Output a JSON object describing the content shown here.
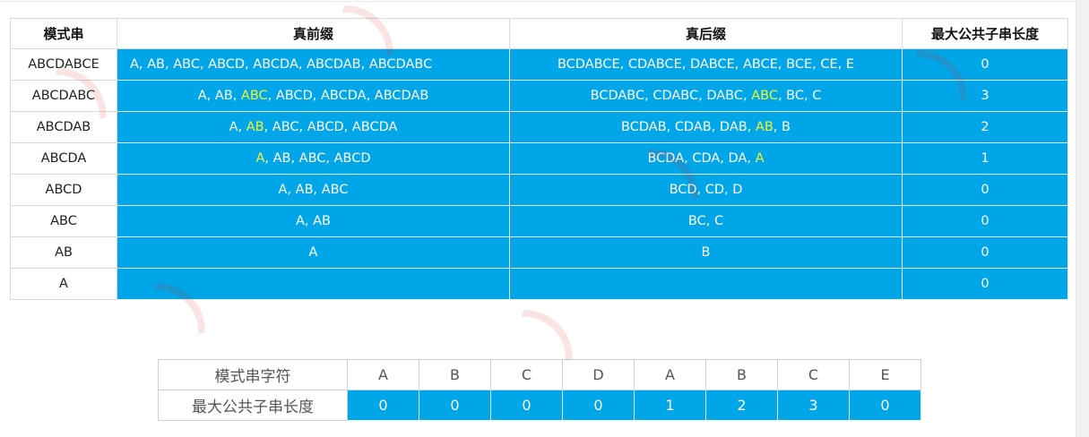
{
  "main_table": {
    "headers": [
      "模式串",
      "真前缀",
      "真后缀",
      "最大公共子串长度"
    ],
    "rows": [
      {
        "pattern": "ABCDABCE",
        "prefix": [
          {
            "t": "A, AB, ABC, ABCD, ABCDA, ABCDAB, ABCDABC"
          }
        ],
        "suffix": [
          {
            "t": "BCDABCE, CDABCE, DABCE, ABCE, BCE, CE, E"
          }
        ],
        "length": "0"
      },
      {
        "pattern": "ABCDABC",
        "prefix": [
          {
            "t": "A, AB, "
          },
          {
            "t": "ABC",
            "hl": true
          },
          {
            "t": ", ABCD, ABCDA, ABCDAB"
          }
        ],
        "suffix": [
          {
            "t": "BCDABC, CDABC, DABC, "
          },
          {
            "t": "ABC",
            "hl": true
          },
          {
            "t": ", BC, C"
          }
        ],
        "length": "3"
      },
      {
        "pattern": "ABCDAB",
        "prefix": [
          {
            "t": "A, "
          },
          {
            "t": "AB",
            "hl": true
          },
          {
            "t": ", ABC, ABCD, ABCDA"
          }
        ],
        "suffix": [
          {
            "t": "BCDAB, CDAB, DAB, "
          },
          {
            "t": "AB",
            "hl": true
          },
          {
            "t": ", B"
          }
        ],
        "length": "2"
      },
      {
        "pattern": "ABCDA",
        "prefix": [
          {
            "t": "A",
            "hl": true
          },
          {
            "t": ", AB, ABC, ABCD"
          }
        ],
        "suffix": [
          {
            "t": "BCDA, CDA, DA, "
          },
          {
            "t": "A",
            "hl": true
          }
        ],
        "length": "1"
      },
      {
        "pattern": "ABCD",
        "prefix": [
          {
            "t": "A, AB, ABC"
          }
        ],
        "suffix": [
          {
            "t": "BCD, CD, D"
          }
        ],
        "length": "0"
      },
      {
        "pattern": "ABC",
        "prefix": [
          {
            "t": "A, AB"
          }
        ],
        "suffix": [
          {
            "t": "BC, C"
          }
        ],
        "length": "0"
      },
      {
        "pattern": "AB",
        "prefix": [
          {
            "t": "A"
          }
        ],
        "suffix": [
          {
            "t": "B"
          }
        ],
        "length": "0"
      },
      {
        "pattern": "A",
        "prefix": [],
        "suffix": [],
        "length": "0"
      }
    ]
  },
  "char_table": {
    "row1_label": "模式串字符",
    "chars": [
      "A",
      "B",
      "C",
      "D",
      "A",
      "B",
      "C",
      "E"
    ],
    "row2_label": "最大公共子串长度",
    "values": [
      "0",
      "0",
      "0",
      "0",
      "1",
      "2",
      "3",
      "0"
    ]
  },
  "colors": {
    "cell_blue": "#00a6e8",
    "highlight_yellow": "#f3f336",
    "watermark_red": "#dc2828"
  }
}
